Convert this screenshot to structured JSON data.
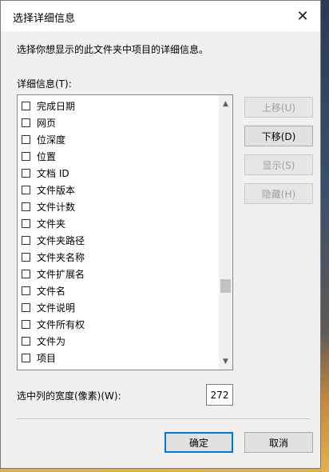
{
  "dialog": {
    "title": "选择详细信息",
    "description": "选择你想显示的此文件夹中项目的详细信息。",
    "list_label": "详细信息(T):",
    "items": [
      {
        "label": "完成日期",
        "checked": false
      },
      {
        "label": "网页",
        "checked": false
      },
      {
        "label": "位深度",
        "checked": false
      },
      {
        "label": "位置",
        "checked": false
      },
      {
        "label": "文档 ID",
        "checked": false
      },
      {
        "label": "文件版本",
        "checked": false
      },
      {
        "label": "文件计数",
        "checked": false
      },
      {
        "label": "文件夹",
        "checked": false
      },
      {
        "label": "文件夹路径",
        "checked": false
      },
      {
        "label": "文件夹名称",
        "checked": false
      },
      {
        "label": "文件扩展名",
        "checked": false
      },
      {
        "label": "文件名",
        "checked": false
      },
      {
        "label": "文件说明",
        "checked": false
      },
      {
        "label": "文件所有权",
        "checked": false
      },
      {
        "label": "文件为",
        "checked": false
      },
      {
        "label": "项目",
        "checked": false
      }
    ],
    "buttons": {
      "move_up": "上移(U)",
      "move_down": "下移(D)",
      "show": "显示(S)",
      "hide": "隐藏(H)",
      "ok": "确定",
      "cancel": "取消"
    },
    "width_label": "选中列的宽度(像素)(W):",
    "width_value": "272",
    "close_glyph": "✕"
  },
  "colors": {
    "accent": "#0078d7",
    "dialog_bg": "#f0f0f0",
    "disabled_text": "#a0a0a0"
  }
}
